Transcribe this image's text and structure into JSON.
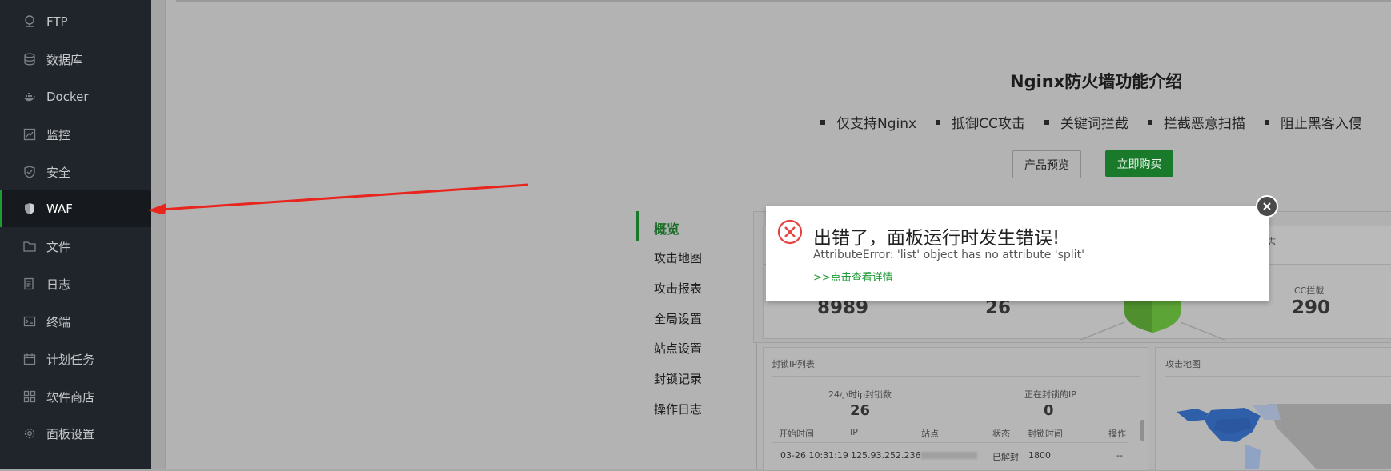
{
  "sidebar": {
    "items": [
      {
        "label": "FTP",
        "icon": "ftp-icon"
      },
      {
        "label": "数据库",
        "icon": "database-icon"
      },
      {
        "label": "Docker",
        "icon": "docker-icon"
      },
      {
        "label": "监控",
        "icon": "monitor-icon"
      },
      {
        "label": "安全",
        "icon": "shield-check-icon"
      },
      {
        "label": "WAF",
        "icon": "waf-shield-icon",
        "active": true
      },
      {
        "label": "文件",
        "icon": "folder-icon"
      },
      {
        "label": "日志",
        "icon": "log-icon"
      },
      {
        "label": "终端",
        "icon": "terminal-icon"
      },
      {
        "label": "计划任务",
        "icon": "calendar-icon"
      },
      {
        "label": "软件商店",
        "icon": "apps-icon"
      },
      {
        "label": "面板设置",
        "icon": "gear-icon"
      }
    ]
  },
  "waf_intro": {
    "title": "Nginx防火墙功能介绍",
    "features": [
      "仅支持Nginx",
      "抵御CC攻击",
      "关键词拦截",
      "拦截恶意扫描",
      "阻止黑客入侵"
    ],
    "preview_button": "产品预览",
    "buy_button": "立即购买"
  },
  "waf_nav": {
    "items": [
      "概览",
      "攻击地图",
      "攻击报表",
      "全局设置",
      "站点设置",
      "封锁记录",
      "操作日志"
    ]
  },
  "overview": {
    "stat1_value": "8989",
    "stat2_value": "26",
    "cc_label": "CC拦截",
    "cc_value": "290",
    "partial_tab": "志"
  },
  "blocked_ip": {
    "title": "封锁IP列表",
    "label_24h": "24小时ip封锁数",
    "value_24h": "26",
    "label_blocking": "正在封锁的IP",
    "value_blocking": "0",
    "columns": [
      "开始时间",
      "IP",
      "站点",
      "状态",
      "封锁时间",
      "操作"
    ],
    "row": {
      "time": "03-26 10:31:19",
      "ip": "125.93.252.236",
      "site": "",
      "status": "已解封",
      "duration": "1800",
      "op": "--"
    }
  },
  "attack_map": {
    "title": "攻击地图"
  },
  "modal": {
    "title": "出错了，面板运行时发生错误!",
    "message": "AttributeError: 'list' object has no attribute 'split'",
    "link": ">>点击查看详情"
  },
  "colors": {
    "sidebar_bg": "#20252b",
    "accent_green": "#1f9a35",
    "error_red": "#e64242",
    "arrow_red": "#e8241c"
  }
}
